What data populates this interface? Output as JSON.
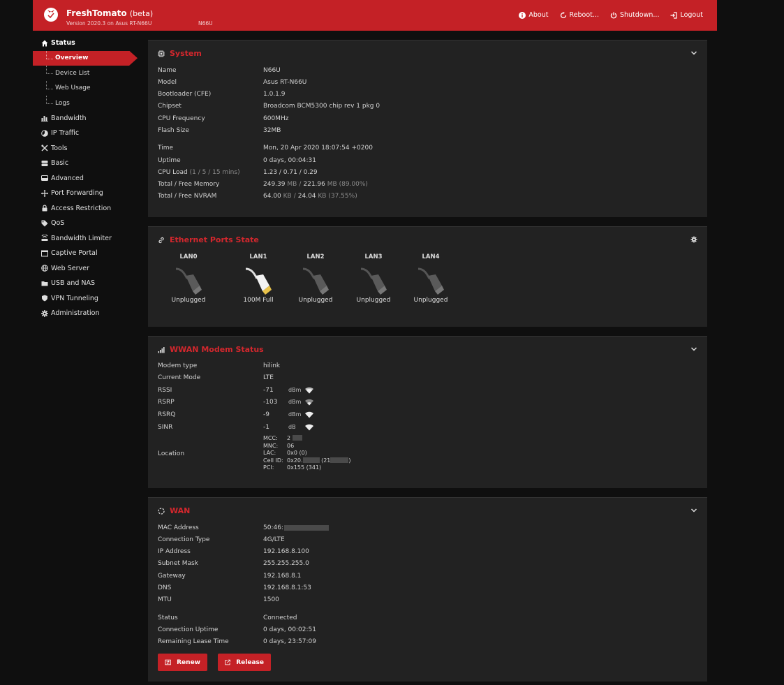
{
  "header": {
    "brand": "FreshTomato",
    "beta": "(beta)",
    "version": "Version 2020.3 on Asus RT-N66U",
    "hostname": "N66U",
    "nav": {
      "about": "About",
      "reboot": "Reboot...",
      "shutdown": "Shutdown...",
      "logout": "Logout"
    }
  },
  "sidebar": {
    "status": "Status",
    "overview": "Overview",
    "device_list": "Device List",
    "web_usage": "Web Usage",
    "logs": "Logs",
    "bandwidth": "Bandwidth",
    "ip_traffic": "IP Traffic",
    "tools": "Tools",
    "basic": "Basic",
    "advanced": "Advanced",
    "port_forwarding": "Port Forwarding",
    "access_restriction": "Access Restriction",
    "qos": "QoS",
    "bandwidth_limiter": "Bandwidth Limiter",
    "captive_portal": "Captive Portal",
    "web_server": "Web Server",
    "usb_nas": "USB and NAS",
    "vpn": "VPN Tunneling",
    "administration": "Administration"
  },
  "system": {
    "title": "System",
    "rows": [
      {
        "k": "Name",
        "v": "N66U"
      },
      {
        "k": "Model",
        "v": "Asus RT-N66U"
      },
      {
        "k": "Bootloader (CFE)",
        "v": "1.0.1.9"
      },
      {
        "k": "Chipset",
        "v": "Broadcom BCM5300 chip rev 1 pkg 0"
      },
      {
        "k": "CPU Frequency",
        "v": "600MHz"
      },
      {
        "k": "Flash Size",
        "v": "32MB"
      },
      {
        "k": "Time",
        "v": "Mon, 20 Apr 2020 18:07:54 +0200"
      },
      {
        "k": "Uptime",
        "v": "0 days, 00:04:31"
      }
    ],
    "cpu_label": "CPU Load",
    "cpu_sub": "(1 / 5 / 15 mins)",
    "cpu_value": "1.23 / 0.71 / 0.29",
    "mem_label": "Total / Free Memory",
    "mem_total": "249.39",
    "mem_free": "221.96",
    "mem_unit": "MB",
    "mem_pct": "(89.00%)",
    "nvram_label": "Total / Free NVRAM",
    "nvram_total": "64.00",
    "nvram_free": "24.04",
    "nvram_unit": "KB",
    "nvram_pct": "(37.55%)",
    "slash": "/"
  },
  "ethernet": {
    "title": "Ethernet Ports State",
    "ports": [
      {
        "label": "LAN0",
        "state": "Unplugged"
      },
      {
        "label": "LAN1",
        "state": "100M Full"
      },
      {
        "label": "LAN2",
        "state": "Unplugged"
      },
      {
        "label": "LAN3",
        "state": "Unplugged"
      },
      {
        "label": "LAN4",
        "state": "Unplugged"
      }
    ]
  },
  "wwan": {
    "title": "WWAN Modem Status",
    "modem_type_label": "Modem type",
    "modem_type": "hilink",
    "mode_label": "Current Mode",
    "mode": "LTE",
    "rssi_label": "RSSI",
    "rssi": "-71",
    "rssi_unit": "dBm",
    "rsrp_label": "RSRP",
    "rsrp": "-103",
    "rsrp_unit": "dBm",
    "rsrq_label": "RSRQ",
    "rsrq": "-9",
    "rsrq_unit": "dBm",
    "sinr_label": "SINR",
    "sinr": "-1",
    "sinr_unit": "dB",
    "location_label": "Location",
    "location": {
      "mcc_label": "MCC:",
      "mcc": "2",
      "mnc_label": "MNC:",
      "mnc": "06",
      "lac_label": "LAC:",
      "lac": "0x0 (0)",
      "cellid_label": "Cell ID:",
      "cellid_a": "0x20.",
      "cellid_b": "(21",
      "cellid_c": ")",
      "pci_label": "PCI:",
      "pci": "0x155 (341)"
    }
  },
  "wan": {
    "title": "WAN",
    "mac_label": "MAC Address",
    "mac": "50:46:",
    "rows": [
      {
        "k": "Connection Type",
        "v": "4G/LTE"
      },
      {
        "k": "IP Address",
        "v": "192.168.8.100"
      },
      {
        "k": "Subnet Mask",
        "v": "255.255.255.0"
      },
      {
        "k": "Gateway",
        "v": "192.168.8.1"
      },
      {
        "k": "DNS",
        "v": "192.168.8.1:53"
      },
      {
        "k": "MTU",
        "v": "1500"
      },
      {
        "k": "Status",
        "v": "Connected"
      },
      {
        "k": "Connection Uptime",
        "v": "0 days, 00:02:51"
      },
      {
        "k": "Remaining Lease Time",
        "v": "0 days, 23:57:09"
      }
    ],
    "renew": "Renew",
    "release": "Release"
  },
  "colors": {
    "accent": "#c42126",
    "panel": "#222222",
    "background": "#0f0f0f"
  }
}
